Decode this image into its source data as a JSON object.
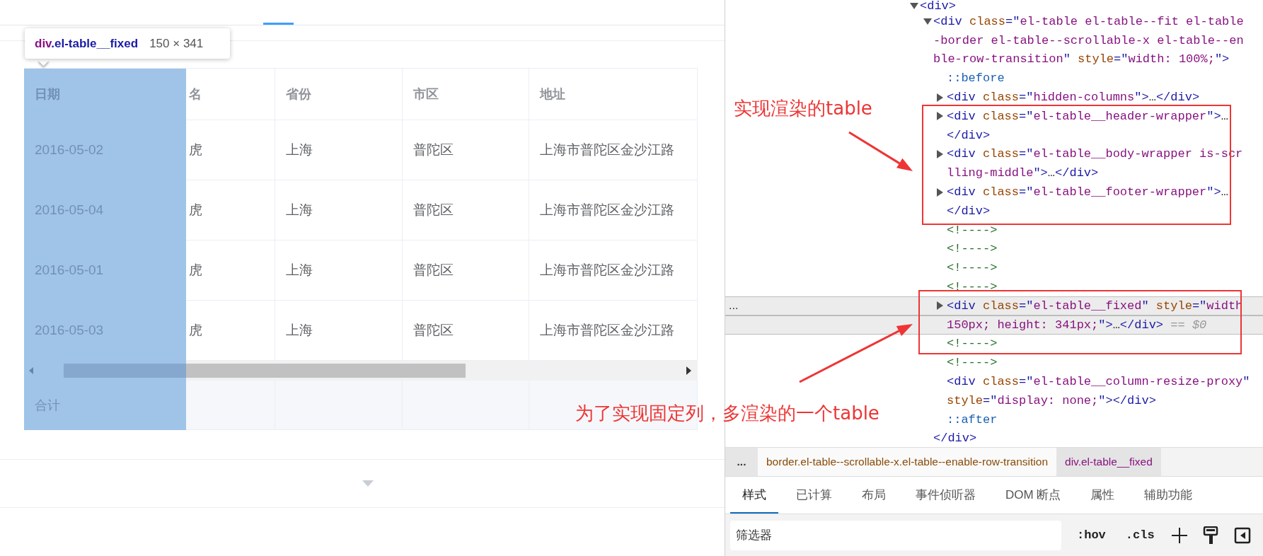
{
  "tooltip": {
    "selector_tag": "div",
    "selector_class": ".el-table__fixed",
    "size": "150 × 341"
  },
  "table": {
    "columns": [
      {
        "label": "日期",
        "highlighted": true
      },
      {
        "label": "名",
        "highlighted": false
      },
      {
        "label": "省份",
        "highlighted": false
      },
      {
        "label": "市区",
        "highlighted": false
      },
      {
        "label": "地址",
        "highlighted": false
      }
    ],
    "rows": [
      [
        "2016-05-02",
        "虎",
        "上海",
        "普陀区",
        "上海市普陀区金沙江路"
      ],
      [
        "2016-05-04",
        "虎",
        "上海",
        "普陀区",
        "上海市普陀区金沙江路"
      ],
      [
        "2016-05-01",
        "虎",
        "上海",
        "普陀区",
        "上海市普陀区金沙江路"
      ],
      [
        "2016-05-03",
        "虎",
        "上海",
        "普陀区",
        "上海市普陀区金沙江路"
      ]
    ],
    "footer": {
      "label": "合计"
    }
  },
  "elements_tree": {
    "nodes": [
      {
        "expanded": true,
        "selected": false,
        "lines": [
          [
            {
              "kind": "tag",
              "text": "<div>"
            }
          ]
        ],
        "children": [
          {
            "expanded": true,
            "selected": false,
            "lines": [
              [
                {
                  "kind": "tag",
                  "text": "<div"
                },
                {
                  "kind": "attr",
                  "text": " class"
                },
                {
                  "kind": "tag",
                  "text": "=\""
                },
                {
                  "kind": "value",
                  "text": "el-table el-table--fit el-table"
                }
              ],
              [
                {
                  "kind": "value",
                  "text": "-border el-table--scrollable-x el-table--en"
                }
              ],
              [
                {
                  "kind": "value",
                  "text": "ble-row-transition"
                },
                {
                  "kind": "tag",
                  "text": "\""
                },
                {
                  "kind": "attr",
                  "text": " style"
                },
                {
                  "kind": "tag",
                  "text": "=\""
                },
                {
                  "kind": "value",
                  "text": "width: 100%;"
                },
                {
                  "kind": "tag",
                  "text": "\">"
                }
              ]
            ],
            "closing": [
              [
                {
                  "kind": "tag",
                  "text": "</div>"
                }
              ]
            ],
            "children": [
              {
                "selected": false,
                "lines": [
                  [
                    {
                      "kind": "pseudo",
                      "text": "::before"
                    }
                  ]
                ]
              },
              {
                "expanded": false,
                "selected": false,
                "lines": [
                  [
                    {
                      "kind": "tag",
                      "text": "<div"
                    },
                    {
                      "kind": "attr",
                      "text": " class"
                    },
                    {
                      "kind": "tag",
                      "text": "=\""
                    },
                    {
                      "kind": "value",
                      "text": "hidden-columns"
                    },
                    {
                      "kind": "tag",
                      "text": "\">"
                    },
                    {
                      "kind": "punct",
                      "text": "…"
                    },
                    {
                      "kind": "tag",
                      "text": "</div>"
                    }
                  ]
                ]
              },
              {
                "expanded": false,
                "selected": false,
                "lines": [
                  [
                    {
                      "kind": "tag",
                      "text": "<div"
                    },
                    {
                      "kind": "attr",
                      "text": " class"
                    },
                    {
                      "kind": "tag",
                      "text": "=\""
                    },
                    {
                      "kind": "value",
                      "text": "el-table__header-wrapper"
                    },
                    {
                      "kind": "tag",
                      "text": "\">"
                    },
                    {
                      "kind": "punct",
                      "text": "…"
                    }
                  ],
                  [
                    {
                      "kind": "tag",
                      "text": "</div>"
                    }
                  ]
                ]
              },
              {
                "expanded": false,
                "selected": false,
                "lines": [
                  [
                    {
                      "kind": "tag",
                      "text": "<div"
                    },
                    {
                      "kind": "attr",
                      "text": " class"
                    },
                    {
                      "kind": "tag",
                      "text": "=\""
                    },
                    {
                      "kind": "value",
                      "text": "el-table__body-wrapper is-scr"
                    }
                  ],
                  [
                    {
                      "kind": "value",
                      "text": "lling-middle"
                    },
                    {
                      "kind": "tag",
                      "text": "\">"
                    },
                    {
                      "kind": "punct",
                      "text": "…"
                    },
                    {
                      "kind": "tag",
                      "text": "</div>"
                    }
                  ]
                ]
              },
              {
                "expanded": false,
                "selected": false,
                "lines": [
                  [
                    {
                      "kind": "tag",
                      "text": "<div"
                    },
                    {
                      "kind": "attr",
                      "text": " class"
                    },
                    {
                      "kind": "tag",
                      "text": "=\""
                    },
                    {
                      "kind": "value",
                      "text": "el-table__footer-wrapper"
                    },
                    {
                      "kind": "tag",
                      "text": "\">"
                    },
                    {
                      "kind": "punct",
                      "text": "…"
                    }
                  ],
                  [
                    {
                      "kind": "tag",
                      "text": "</div>"
                    }
                  ]
                ]
              },
              {
                "selected": false,
                "lines": [
                  [
                    {
                      "kind": "comment",
                      "text": "<!---->"
                    }
                  ]
                ]
              },
              {
                "selected": false,
                "lines": [
                  [
                    {
                      "kind": "comment",
                      "text": "<!---->"
                    }
                  ]
                ]
              },
              {
                "selected": false,
                "lines": [
                  [
                    {
                      "kind": "comment",
                      "text": "<!---->"
                    }
                  ]
                ]
              },
              {
                "selected": false,
                "lines": [
                  [
                    {
                      "kind": "comment",
                      "text": "<!---->"
                    }
                  ]
                ]
              },
              {
                "expanded": false,
                "selected": true,
                "gutter": "...",
                "lines": [
                  [
                    {
                      "kind": "tag",
                      "text": "<div"
                    },
                    {
                      "kind": "attr",
                      "text": " class"
                    },
                    {
                      "kind": "tag",
                      "text": "=\""
                    },
                    {
                      "kind": "value",
                      "text": "el-table__fixed"
                    },
                    {
                      "kind": "tag",
                      "text": "\""
                    },
                    {
                      "kind": "attr",
                      "text": " style"
                    },
                    {
                      "kind": "tag",
                      "text": "=\""
                    },
                    {
                      "kind": "value",
                      "text": "width"
                    }
                  ],
                  [
                    {
                      "kind": "value",
                      "text": "150px; height: 341px;"
                    },
                    {
                      "kind": "tag",
                      "text": "\">"
                    },
                    {
                      "kind": "punct",
                      "text": "…"
                    },
                    {
                      "kind": "tag",
                      "text": "</div>"
                    },
                    {
                      "kind": "note",
                      "text": " == $0"
                    }
                  ]
                ]
              },
              {
                "selected": false,
                "lines": [
                  [
                    {
                      "kind": "comment",
                      "text": "<!---->"
                    }
                  ]
                ]
              },
              {
                "selected": false,
                "lines": [
                  [
                    {
                      "kind": "comment",
                      "text": "<!---->"
                    }
                  ]
                ]
              },
              {
                "selected": false,
                "lines": [
                  [
                    {
                      "kind": "tag",
                      "text": "<div"
                    },
                    {
                      "kind": "attr",
                      "text": " class"
                    },
                    {
                      "kind": "tag",
                      "text": "=\""
                    },
                    {
                      "kind": "value",
                      "text": "el-table__column-resize-proxy"
                    },
                    {
                      "kind": "tag",
                      "text": "\""
                    }
                  ],
                  [
                    {
                      "kind": "attr",
                      "text": "style"
                    },
                    {
                      "kind": "tag",
                      "text": "=\""
                    },
                    {
                      "kind": "value",
                      "text": "display: none;"
                    },
                    {
                      "kind": "tag",
                      "text": "\">"
                    },
                    {
                      "kind": "tag",
                      "text": "</div>"
                    }
                  ]
                ]
              },
              {
                "selected": false,
                "lines": [
                  [
                    {
                      "kind": "pseudo",
                      "text": "::after"
                    }
                  ]
                ]
              }
            ]
          }
        ]
      }
    ]
  },
  "breadcrumbs": {
    "overflow": "...",
    "items": [
      {
        "text": "border.el-table--scrollable-x.el-table--enable-row-transition",
        "kind": "classes",
        "selected": false
      },
      {
        "text": "div.el-table__fixed",
        "kind": "tag",
        "selected": true
      }
    ]
  },
  "panel_tabs": [
    {
      "label": "样式",
      "selected": true
    },
    {
      "label": "已计算",
      "selected": false
    },
    {
      "label": "布局",
      "selected": false
    },
    {
      "label": "事件侦听器",
      "selected": false
    },
    {
      "label": "DOM 断点",
      "selected": false
    },
    {
      "label": "属性",
      "selected": false
    },
    {
      "label": "辅助功能",
      "selected": false
    }
  ],
  "filter": {
    "placeholder": "筛选器",
    "buttons": [
      ":hov",
      ".cls"
    ]
  },
  "annotations": [
    {
      "text": "实现渲染的table"
    },
    {
      "text": "为了实现固定列，多渲染的一个table"
    }
  ]
}
